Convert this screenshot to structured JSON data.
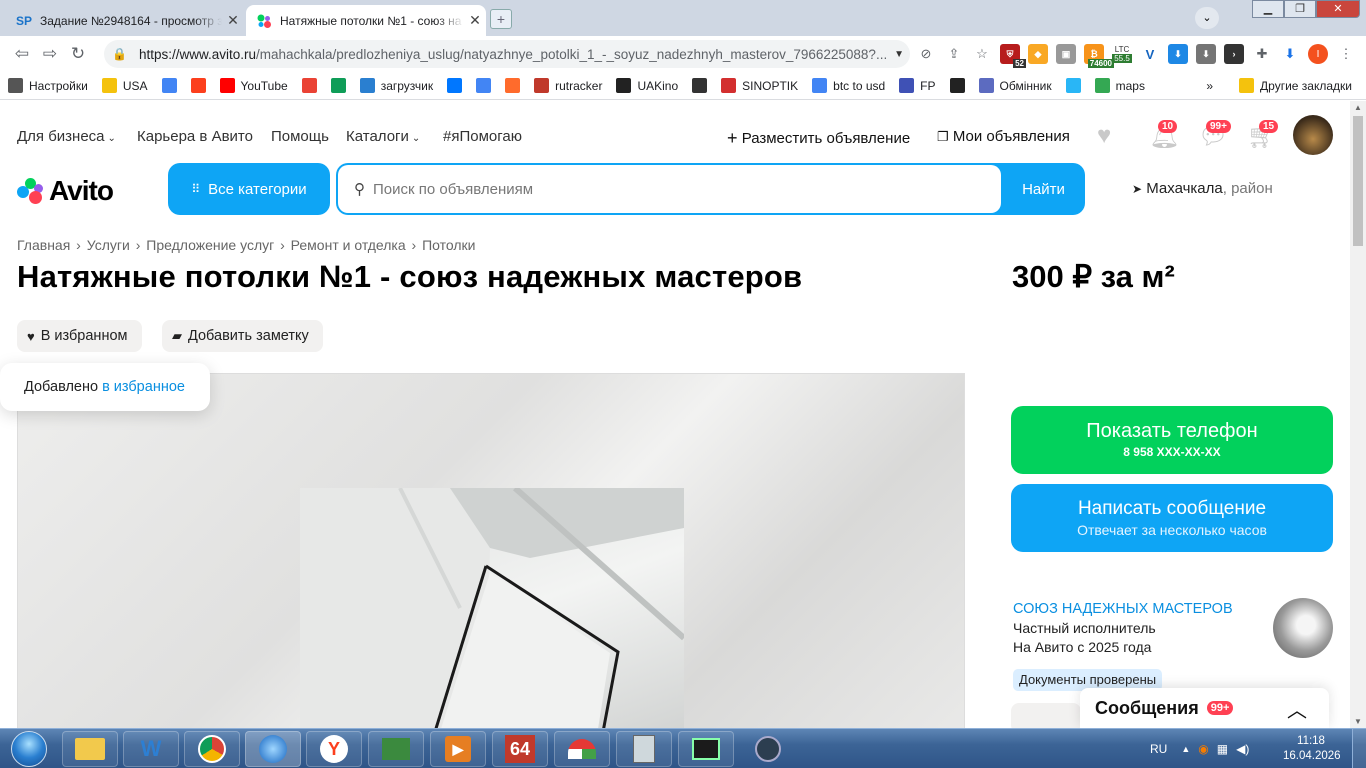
{
  "browser": {
    "tabs": [
      {
        "title": "Задание №2948164 - просмотр з",
        "favicon": "SP"
      },
      {
        "title": "Натяжные потолки №1 - союз на",
        "favicon": "avito-dots"
      }
    ],
    "window_controls": {
      "minimize": "▁",
      "restore": "❐",
      "close": "✕"
    },
    "url_domain": "https://www.avito.ru",
    "url_path": "/mahachkala/predlozheniya_uslug/natyazhnye_potolki_1_-_soyuz_nadezhnyh_masterov_7966225088?...",
    "extension_badges": {
      "e1": "52",
      "btc": "74600",
      "ltc": "LTC",
      "ltc_val": "55.5"
    },
    "profile_letter": "I",
    "bookmarks": [
      {
        "label": "Настройки",
        "icon": "gear-icon",
        "color": "#555"
      },
      {
        "label": "USA",
        "icon": "folder-icon",
        "color": "#f4c20d"
      },
      {
        "label": "",
        "icon": "google-icon",
        "color": "#4285f4"
      },
      {
        "label": "",
        "icon": "yandex-icon",
        "color": "#fc3f1d"
      },
      {
        "label": "YouTube",
        "icon": "youtube-icon",
        "color": "#ff0000"
      },
      {
        "label": "",
        "icon": "gmail-icon",
        "color": "#ea4335"
      },
      {
        "label": "",
        "icon": "drive-icon",
        "color": "#0f9d58"
      },
      {
        "label": "загрузчик",
        "icon": "download-icon",
        "color": "#2a7fd0"
      },
      {
        "label": "",
        "icon": "vk-icon",
        "color": "#0077ff"
      },
      {
        "label": "",
        "icon": "translate-icon",
        "color": "#4285f4"
      },
      {
        "label": "",
        "icon": "f-icon",
        "color": "#ff6b2c"
      },
      {
        "label": "rutracker",
        "icon": "rutracker-icon",
        "color": "#c0392b"
      },
      {
        "label": "UAKino",
        "icon": "uakino-icon",
        "color": "#222"
      },
      {
        "label": "",
        "icon": "knight-icon",
        "color": "#333"
      },
      {
        "label": "SINOPTIK",
        "icon": "thermometer-icon",
        "color": "#d32f2f"
      },
      {
        "label": "btc to usd",
        "icon": "google-icon",
        "color": "#4285f4"
      },
      {
        "label": "FP",
        "icon": "fp-icon",
        "color": "#3f51b5"
      },
      {
        "label": "",
        "icon": "bc-icon",
        "color": "#222"
      },
      {
        "label": "Обмінник",
        "icon": "exchange-icon",
        "color": "#5c6bc0"
      },
      {
        "label": "",
        "icon": "snowflake-icon",
        "color": "#29b6f6"
      },
      {
        "label": "maps",
        "icon": "maps-icon",
        "color": "#34a853"
      }
    ],
    "bookmarks_overflow": "»",
    "other_bookmarks": "Другие закладки"
  },
  "header": {
    "nav": [
      {
        "label": "Для бизнеса",
        "dropdown": true
      },
      {
        "label": "Карьера в Авито",
        "dropdown": false
      },
      {
        "label": "Помощь",
        "dropdown": false
      },
      {
        "label": "Каталоги",
        "dropdown": true
      },
      {
        "label": "#яПомогаю",
        "dropdown": false
      }
    ],
    "post_ad": "Разместить объявление",
    "my_ads": "Мои объявления",
    "badges": {
      "notifications": "10",
      "messages": "99+",
      "cart": "15"
    },
    "logo_text": "Avito",
    "all_categories": "Все категории",
    "search_placeholder": "Поиск по объявлениям",
    "search_button": "Найти",
    "location_city": "Махачкала",
    "location_suffix": ", район"
  },
  "breadcrumbs": [
    "Главная",
    "Услуги",
    "Предложение услуг",
    "Ремонт и отделка",
    "Потолки"
  ],
  "listing": {
    "title": "Натяжные потолки №1 - союз надежных мастеров",
    "price": "300 ₽ за м²",
    "favorite_chip": "В избранном",
    "note_chip": "Добавить заметку",
    "toast_prefix": "Добавлено",
    "toast_link": "в избранное"
  },
  "contact": {
    "phone_title": "Показать телефон",
    "phone_masked": "8 958 XXX-XX-XX",
    "message_title": "Написать сообщение",
    "message_sub": "Отвечает за несколько часов"
  },
  "seller": {
    "name": "СОЮЗ НАДЕЖНЫХ МАСТЕРОВ",
    "type": "Частный исполнитель",
    "since": "На Авито с 2025 года",
    "docs_badge": "Документы проверены"
  },
  "messages_panel": {
    "label": "Сообщения",
    "badge": "99+"
  },
  "taskbar": {
    "lang": "RU",
    "time": "11:18",
    "date": "16.04.2026",
    "app_64": "64"
  },
  "colors": {
    "avito_blue": "#0ea5f5",
    "avito_green": "#02d15c",
    "badge_red": "#ff4053"
  }
}
